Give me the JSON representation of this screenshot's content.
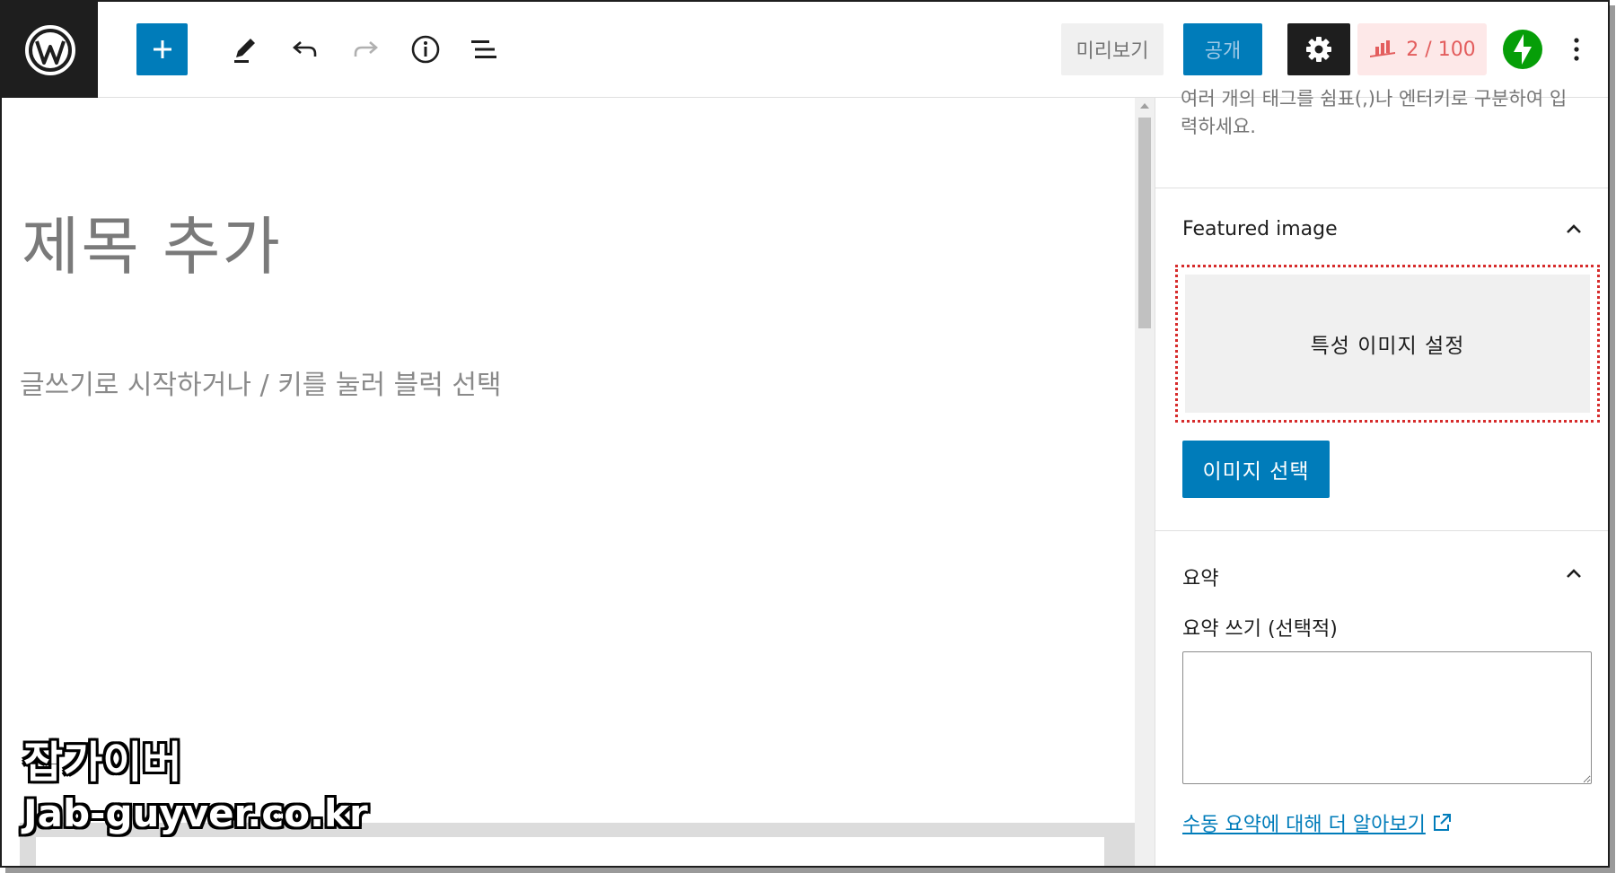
{
  "toolbar": {
    "preview_label": "미리보기",
    "publish_label": "공개",
    "seo_score": "2 / 100"
  },
  "editor": {
    "title_placeholder": "제목 추가",
    "paragraph_placeholder": "글쓰기로 시작하거나 / 키를 눌러 블럭 선택"
  },
  "sidebar": {
    "tags_help": "여러 개의 태그를 쉼표(,)나 엔터키로 구분하여 입력하세요.",
    "featured_image": {
      "title": "Featured image",
      "set_label": "특성 이미지 설정",
      "select_button": "이미지 선택"
    },
    "excerpt": {
      "title": "요약",
      "field_label": "요약 쓰기 (선택적)",
      "value": "",
      "learn_more_link": "수동 요약에 대해 더 알아보기"
    }
  },
  "watermark": {
    "line1": "잡가이버",
    "line2": "Jab-guyver.co.kr"
  },
  "colors": {
    "accent": "#007cba",
    "dark": "#1e1e1e",
    "highlight_border": "#d62b2b",
    "jetpack_green": "#069e08",
    "seo_red": "#e35d5d"
  }
}
